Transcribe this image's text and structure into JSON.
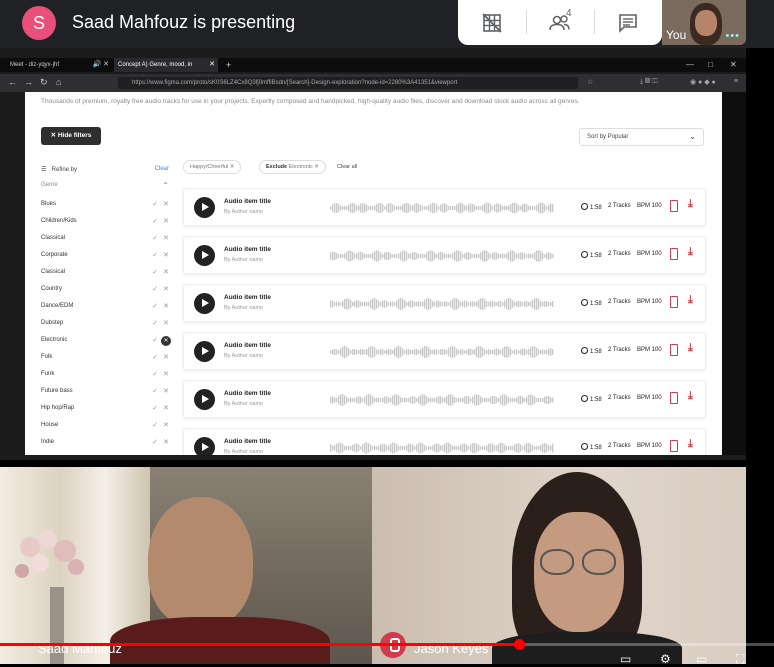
{
  "meet": {
    "avatar_letter": "S",
    "presenting_text": "Saad Mahfouz is presenting",
    "people_count": "4",
    "self_label": "You",
    "self_dots": "•••"
  },
  "browser": {
    "tabs": [
      {
        "label": "Meet - diz-yqyx-jhf"
      },
      {
        "label": "Concept A) Genre, mood, in"
      }
    ],
    "url": "https://www.figma.com/proto/sK0S6LZ4Cx8Q3fj0mffiBsdn/[Search]-Design-exploration?node-id=2280%3A41351&viewport",
    "window_controls": [
      "—",
      "□",
      "✕"
    ]
  },
  "app": {
    "intro": "Thousands of premium, royalty free audio tracks for use in your projects. Expertly composed and handpicked, high-quality audio files, discover and download stock audio across all genres.",
    "hide_filters": "✕  Hide filters",
    "sort": "Sort by Popular",
    "refine_by": "Refine by",
    "clear": "Clear",
    "genre_heading": "Genre",
    "genres": [
      "Blues",
      "Children/Kids",
      "Classical",
      "Corporate",
      "Classical",
      "Country",
      "Dance/EDM",
      "Dubstep",
      "Electronic",
      "Folk",
      "Funk",
      "Future bass",
      "Hip hop/Rap",
      "House",
      "Indie"
    ],
    "excluded_genre": "Electronic",
    "chips": {
      "mood": "Happy/Cheerful",
      "exclude_label": "Exclude",
      "exclude_value": "Electronic",
      "clear_all": "Clear all"
    },
    "tracks": [
      {
        "title": "Audio item title",
        "author": "By Author name",
        "duration": "1:58",
        "tracks": "2 Tracks",
        "bpm": "BPM 100"
      },
      {
        "title": "Audio item title",
        "author": "By Author name",
        "duration": "1:58",
        "tracks": "2 Tracks",
        "bpm": "BPM 100"
      },
      {
        "title": "Audio item title",
        "author": "By Author name",
        "duration": "1:58",
        "tracks": "2 Tracks",
        "bpm": "BPM 100"
      },
      {
        "title": "Audio item title",
        "author": "By Author name",
        "duration": "1:58",
        "tracks": "2 Tracks",
        "bpm": "BPM 100"
      },
      {
        "title": "Audio item title",
        "author": "By Author name",
        "duration": "1:58",
        "tracks": "2 Tracks",
        "bpm": "BPM 100"
      },
      {
        "title": "Audio item title",
        "author": "By Author name",
        "duration": "1:58",
        "tracks": "2 Tracks",
        "bpm": "BPM 100"
      }
    ]
  },
  "participants": [
    {
      "name": "Saad Mahfouz"
    },
    {
      "name": "Jason Keyes"
    }
  ],
  "video": {
    "progress": 0.67
  },
  "colors": {
    "accent": "#d23a4e",
    "meet_bg": "#202124",
    "avatar": "#e8507a",
    "progress": "#ff0000"
  }
}
